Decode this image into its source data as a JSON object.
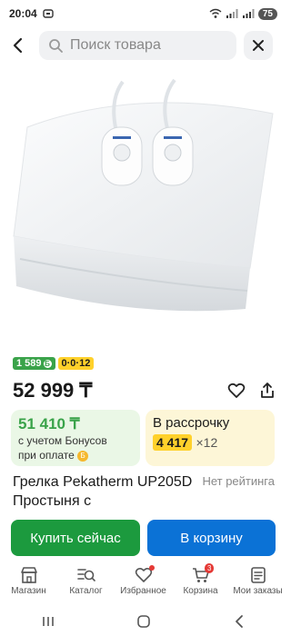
{
  "status": {
    "time": "20:04",
    "battery": "75"
  },
  "search": {
    "placeholder": "Поиск товара"
  },
  "badges": {
    "bonus": "1 589",
    "bonus_icon": "Б",
    "plan": "0·0·12"
  },
  "price": {
    "current": "52 999 ₸"
  },
  "bonus_card": {
    "amount": "51 410 ₸",
    "line1": "с учетом Бонусов",
    "line2": "при оплате",
    "coin_icon": "Б"
  },
  "installment_card": {
    "label": "В рассрочку",
    "monthly": "4 417",
    "months": "×12"
  },
  "product": {
    "title": "Грелка Pekatherm UP205D Простыня с",
    "rating": "Нет рейтинга"
  },
  "buttons": {
    "buy_now": "Купить сейчас",
    "add_to_cart": "В корзину"
  },
  "tabbar": {
    "items": [
      {
        "label": "Магазин",
        "icon": "shop-icon"
      },
      {
        "label": "Каталог",
        "icon": "catalog-search-icon"
      },
      {
        "label": "Избранное",
        "icon": "heart-icon"
      },
      {
        "label": "Корзина",
        "icon": "cart-icon",
        "badge": "3"
      },
      {
        "label": "Мои заказы",
        "icon": "orders-icon"
      }
    ]
  },
  "colors": {
    "green": "#3aa34a",
    "yellow": "#ffd12b",
    "blue": "#0b72d6",
    "buy_green": "#1c9a3e"
  }
}
